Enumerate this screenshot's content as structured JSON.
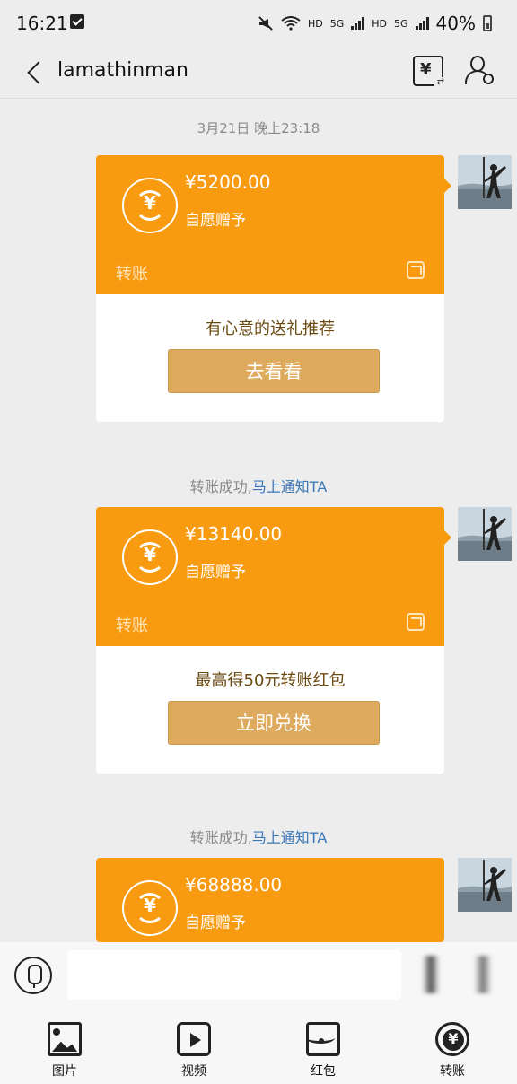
{
  "status_bar": {
    "time": "16:21",
    "network_1": "HD",
    "network_2": "5G",
    "network_3": "HD",
    "network_4": "5G",
    "battery": "40%"
  },
  "header": {
    "title": "lamathinman"
  },
  "messages": {
    "timestamp": "3月21日 晚上23:18",
    "notes": [
      {
        "text": "转账成功,",
        "link": "马上通知TA"
      },
      {
        "text": "转账成功,",
        "link": "马上通知TA"
      }
    ],
    "transfers": [
      {
        "amount": "¥5200.00",
        "remark": "自愿赠予",
        "label": "转账",
        "promo": "有心意的送礼推荐",
        "button": "去看看"
      },
      {
        "amount": "¥13140.00",
        "remark": "自愿赠予",
        "label": "转账",
        "promo": "最高得50元转账红包",
        "button": "立即兑换"
      },
      {
        "amount": "¥68888.00",
        "remark": "自愿赠予"
      }
    ],
    "coin_symbol": "¥"
  },
  "toolbar": {
    "items": [
      {
        "label": "图片",
        "icon": "image-icon"
      },
      {
        "label": "视频",
        "icon": "video-icon"
      },
      {
        "label": "红包",
        "icon": "red-packet-icon"
      },
      {
        "label": "转账",
        "icon": "transfer-icon"
      }
    ]
  },
  "colors": {
    "card_orange": "#f99b11",
    "button_gold": "#deab5e",
    "link_blue": "#3b78b8"
  }
}
